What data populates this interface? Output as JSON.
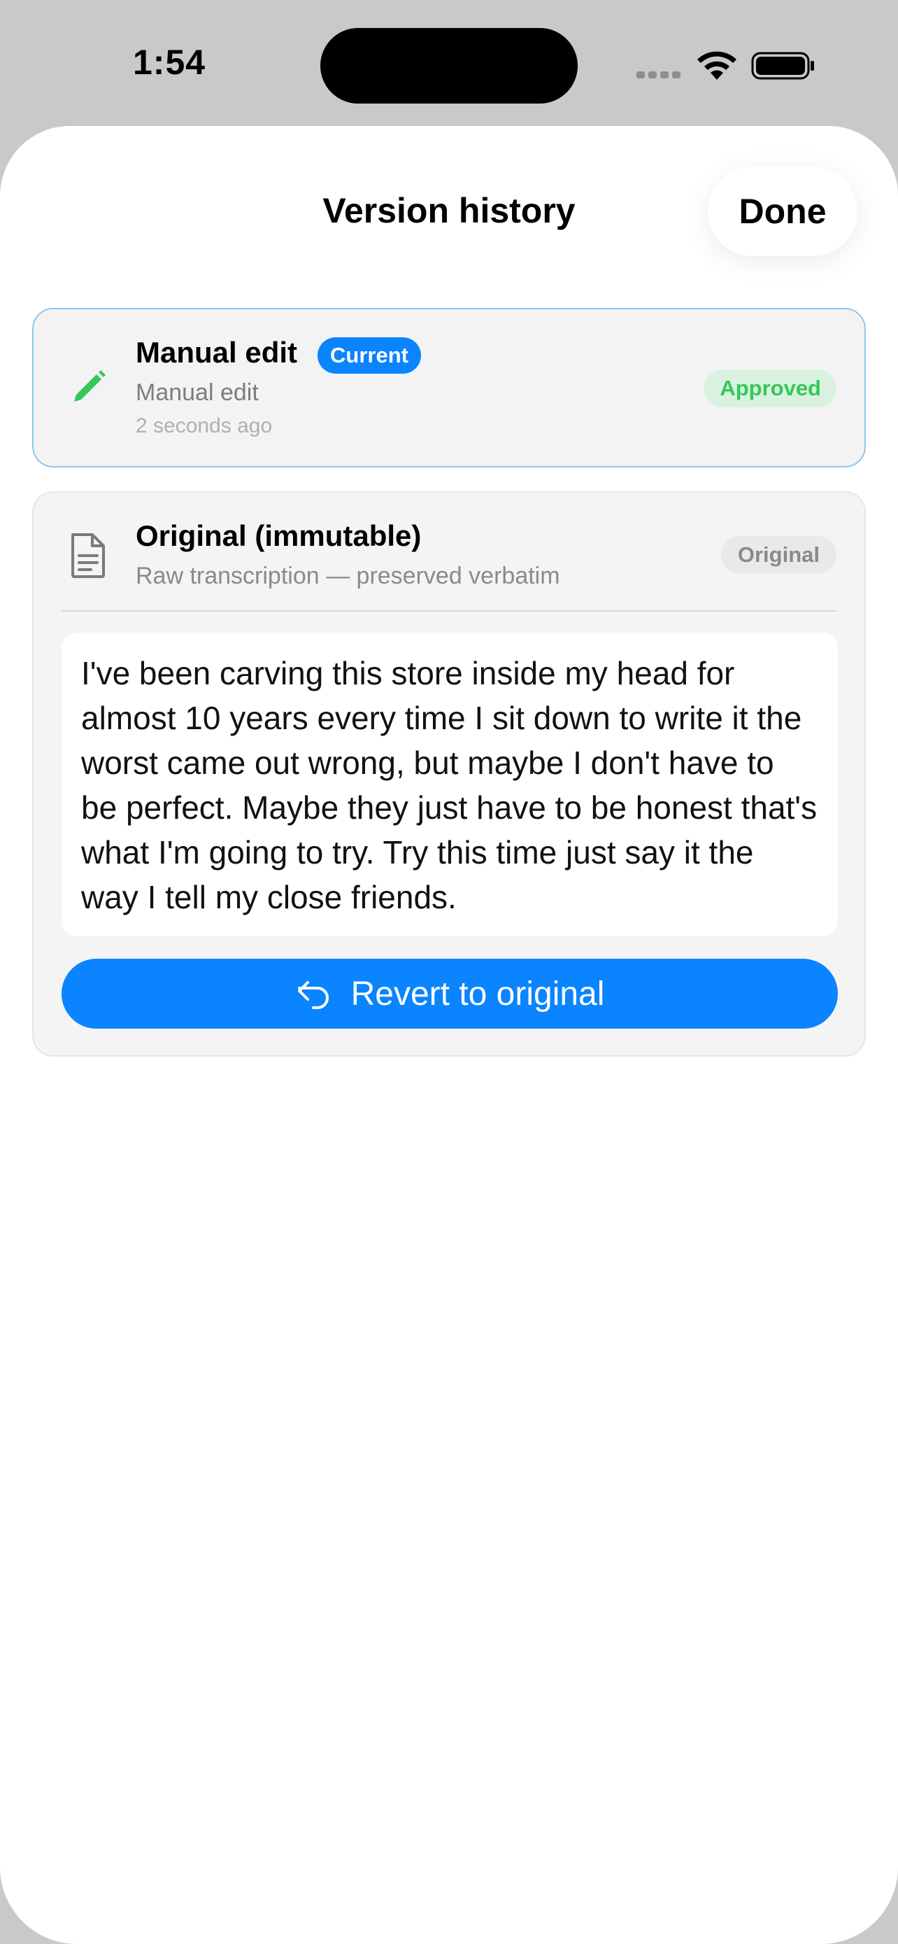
{
  "status_bar": {
    "time": "1:54",
    "icons": [
      "signal-icon",
      "wifi-icon",
      "battery-icon"
    ]
  },
  "header": {
    "title": "Version history",
    "done_label": "Done"
  },
  "versions": [
    {
      "icon": "pencil-icon",
      "title": "Manual edit",
      "current_badge": "Current",
      "subtitle": "Manual edit",
      "time": "2 seconds ago",
      "status_badge": "Approved"
    },
    {
      "icon": "document-icon",
      "title": "Original (immutable)",
      "subtitle": "Raw transcription — preserved verbatim",
      "status_badge": "Original",
      "text": "I've been carving this store inside my head for almost 10 years every time I sit down to write it the worst came out wrong, but maybe I don't have to be perfect. Maybe they just have to be honest that's what I'm going to try. Try this time just say it the way I tell my close friends.",
      "revert_label": "Revert to original"
    }
  ],
  "colors": {
    "accent": "#0a84ff",
    "approved": "#34c759",
    "current_border": "#8ec7f2"
  }
}
